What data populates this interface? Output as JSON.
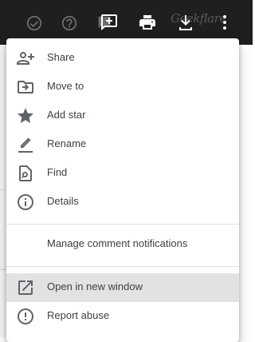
{
  "toolbar": {
    "brand_text": "Geekflare",
    "icons": [
      "check-circle-icon",
      "help-icon",
      "add-comment-icon",
      "print-icon",
      "download-icon",
      "more-vert-icon"
    ]
  },
  "menu": {
    "items": [
      {
        "label": "Share",
        "icon": "person-add-icon"
      },
      {
        "label": "Move to",
        "icon": "move-to-folder-icon"
      },
      {
        "label": "Add star",
        "icon": "star-icon"
      },
      {
        "label": "Rename",
        "icon": "rename-pencil-icon"
      },
      {
        "label": "Find",
        "icon": "find-in-page-icon"
      },
      {
        "label": "Details",
        "icon": "info-icon"
      },
      {
        "label": "Manage comment notifications",
        "icon": ""
      },
      {
        "label": "Open in new window",
        "icon": "open-in-new-icon",
        "highlighted": true
      },
      {
        "label": "Report abuse",
        "icon": "report-icon"
      }
    ]
  },
  "colors": {
    "toolbar_bg": "#1f1f1f",
    "menu_text": "#3c4043",
    "icon": "#5f6368",
    "hover_bg": "#e2e2e2",
    "divider": "#e0e0e0"
  }
}
